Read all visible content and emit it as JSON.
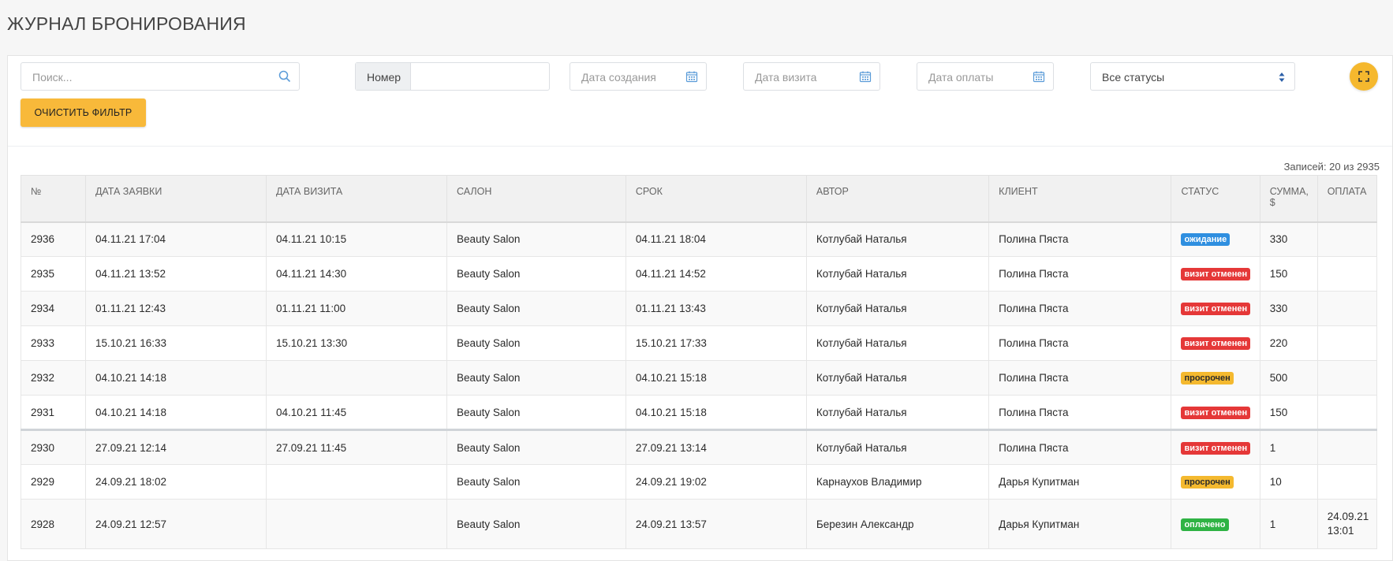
{
  "page": {
    "title": "ЖУРНАЛ БРОНИРОВАНИЯ"
  },
  "filters": {
    "search_placeholder": "Поиск...",
    "number_label": "Номер",
    "created_placeholder": "Дата создания",
    "visit_placeholder": "Дата визита",
    "payment_placeholder": "Дата оплаты",
    "status_selected": "Все статусы",
    "clear_label": "ОЧИСТИТЬ ФИЛЬТР"
  },
  "records_info": "Записей: 20 из 2935",
  "table": {
    "headers": [
      "№",
      "ДАТА ЗАЯВКИ",
      "ДАТА ВИЗИТА",
      "САЛОН",
      "СРОК",
      "АВТОР",
      "КЛИЕНТ",
      "СТАТУС",
      "СУММА, $",
      "ОПЛАТА"
    ],
    "rows": [
      {
        "num": "2936",
        "created": "04.11.21 17:04",
        "visit": "04.11.21 10:15",
        "salon": "Beauty Salon",
        "deadline": "04.11.21 18:04",
        "author": "Котлубай Наталья",
        "client": "Полина Пяста",
        "status": "ожидание",
        "status_kind": "waiting",
        "sum": "330",
        "payment": ""
      },
      {
        "num": "2935",
        "created": "04.11.21 13:52",
        "visit": "04.11.21 14:30",
        "salon": "Beauty Salon",
        "deadline": "04.11.21 14:52",
        "author": "Котлубай Наталья",
        "client": "Полина Пяста",
        "status": "визит отменен",
        "status_kind": "cancelled",
        "sum": "150",
        "payment": ""
      },
      {
        "num": "2934",
        "created": "01.11.21 12:43",
        "visit": "01.11.21 11:00",
        "salon": "Beauty Salon",
        "deadline": "01.11.21 13:43",
        "author": "Котлубай Наталья",
        "client": "Полина Пяста",
        "status": "визит отменен",
        "status_kind": "cancelled",
        "sum": "330",
        "payment": ""
      },
      {
        "num": "2933",
        "created": "15.10.21 16:33",
        "visit": "15.10.21 13:30",
        "salon": "Beauty Salon",
        "deadline": "15.10.21 17:33",
        "author": "Котлубай Наталья",
        "client": "Полина Пяста",
        "status": "визит отменен",
        "status_kind": "cancelled",
        "sum": "220",
        "payment": ""
      },
      {
        "num": "2932",
        "created": "04.10.21 14:18",
        "visit": "",
        "salon": "Beauty Salon",
        "deadline": "04.10.21 15:18",
        "author": "Котлубай Наталья",
        "client": "Полина Пяста",
        "status": "просрочен",
        "status_kind": "overdue",
        "sum": "500",
        "payment": ""
      },
      {
        "num": "2931",
        "created": "04.10.21 14:18",
        "visit": "04.10.21 11:45",
        "salon": "Beauty Salon",
        "deadline": "04.10.21 15:18",
        "author": "Котлубай Наталья",
        "client": "Полина Пяста",
        "status": "визит отменен",
        "status_kind": "cancelled",
        "sum": "150",
        "payment": ""
      },
      {
        "num": "2930",
        "created": "27.09.21 12:14",
        "visit": "27.09.21 11:45",
        "salon": "Beauty Salon",
        "deadline": "27.09.21 13:14",
        "author": "Котлубай Наталья",
        "client": "Полина Пяста",
        "status": "визит отменен",
        "status_kind": "cancelled",
        "sum": "1",
        "payment": ""
      },
      {
        "num": "2929",
        "created": "24.09.21 18:02",
        "visit": "",
        "salon": "Beauty Salon",
        "deadline": "24.09.21 19:02",
        "author": "Карнаухов Владимир",
        "client": "Дарья Купитман",
        "status": "просрочен",
        "status_kind": "overdue",
        "sum": "10",
        "payment": ""
      },
      {
        "num": "2928",
        "created": "24.09.21 12:57",
        "visit": "",
        "salon": "Beauty Salon",
        "deadline": "24.09.21 13:57",
        "author": "Березин Александр",
        "client": "Дарья Купитман",
        "status": "оплачено",
        "status_kind": "paid",
        "sum": "1",
        "payment": "24.09.21 13:01"
      }
    ]
  },
  "colors": {
    "waiting": "#2f8fe0",
    "cancelled": "#e53838",
    "overdue": "#f4b92f",
    "paid": "#2fb344",
    "accent": "#f8b93a"
  }
}
